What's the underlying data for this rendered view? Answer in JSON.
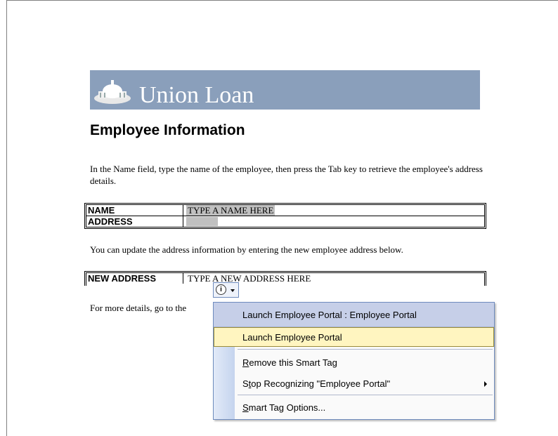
{
  "banner": {
    "title": "Union Loan"
  },
  "heading": "Employee Information",
  "intro": "In the Name field, type the name of the employee, then press the Tab key to retrieve the employee's address details.",
  "table1": {
    "rows": [
      {
        "label": "NAME",
        "value": "TYPE A NAME HERE"
      },
      {
        "label": "ADDRESS",
        "value": ""
      }
    ]
  },
  "para2": "You can update the address information by entering the new employee address below.",
  "table2": {
    "label": "NEW ADDRESS",
    "value": "TYPE A NEW ADDRESS HERE"
  },
  "para3": "For more details, go to the",
  "smarttag": {
    "icon": "info-icon"
  },
  "menu": {
    "header": "Launch Employee Portal : Employee Portal",
    "items": [
      {
        "label": "Launch Employee Portal"
      },
      {
        "label_pre": "",
        "label_u": "R",
        "label_post": "emove this Smart Tag"
      },
      {
        "label_pre": "S",
        "label_u": "t",
        "label_post": "op Recognizing \"Employee Portal\""
      },
      {
        "label_pre": "",
        "label_u": "S",
        "label_post": "mart Tag Options..."
      }
    ]
  }
}
